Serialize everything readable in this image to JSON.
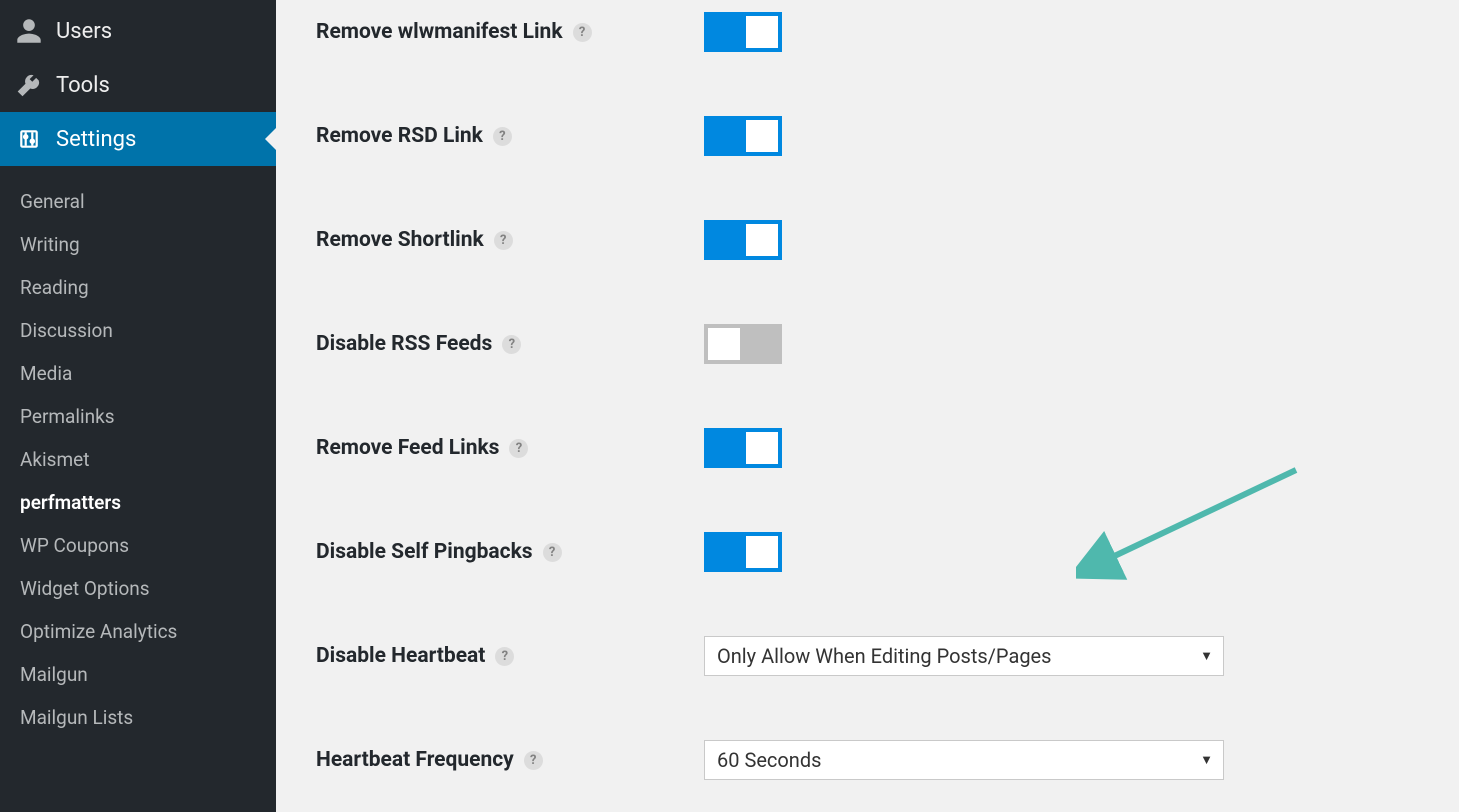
{
  "sidebar": {
    "top": [
      {
        "label": "Users",
        "icon": "user"
      },
      {
        "label": "Tools",
        "icon": "wrench"
      },
      {
        "label": "Settings",
        "icon": "sliders",
        "current": true
      }
    ],
    "sub": [
      {
        "label": "General"
      },
      {
        "label": "Writing"
      },
      {
        "label": "Reading"
      },
      {
        "label": "Discussion"
      },
      {
        "label": "Media"
      },
      {
        "label": "Permalinks"
      },
      {
        "label": "Akismet"
      },
      {
        "label": "perfmatters",
        "active": true
      },
      {
        "label": "WP Coupons"
      },
      {
        "label": "Widget Options"
      },
      {
        "label": "Optimize Analytics"
      },
      {
        "label": "Mailgun"
      },
      {
        "label": "Mailgun Lists"
      }
    ]
  },
  "settings": {
    "rows": [
      {
        "label": "Remove wlwmanifest Link",
        "type": "toggle",
        "on": true
      },
      {
        "label": "Remove RSD Link",
        "type": "toggle",
        "on": true
      },
      {
        "label": "Remove Shortlink",
        "type": "toggle",
        "on": true
      },
      {
        "label": "Disable RSS Feeds",
        "type": "toggle",
        "on": false
      },
      {
        "label": "Remove Feed Links",
        "type": "toggle",
        "on": true
      },
      {
        "label": "Disable Self Pingbacks",
        "type": "toggle",
        "on": true
      },
      {
        "label": "Disable Heartbeat",
        "type": "select",
        "value": "Only Allow When Editing Posts/Pages"
      },
      {
        "label": "Heartbeat Frequency",
        "type": "select",
        "value": "60 Seconds"
      }
    ]
  },
  "help_glyph": "?",
  "colors": {
    "accent": "#0088e0",
    "sidebar_bg": "#23282d",
    "arrow": "#4fb8ad"
  }
}
